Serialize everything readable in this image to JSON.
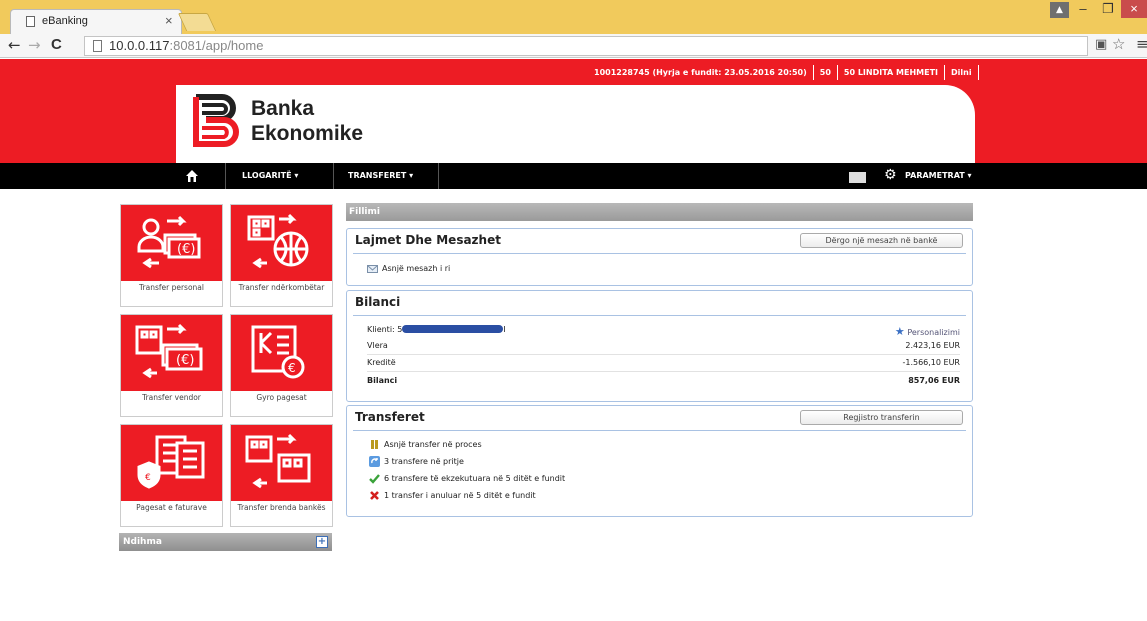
{
  "browser": {
    "tab_title": "eBanking",
    "tab_close": "×",
    "url_host": "10.0.0.117",
    "url_rest": ":8081/app/home",
    "back": "←",
    "forward": "→",
    "reload": "C",
    "window_minimize": "–",
    "window_restore": "❐",
    "window_close": "×",
    "user_glyph": "▲"
  },
  "userbar": {
    "login_info": "1001228745  (Hyrja e fundit: 23.05.2016 20:50)",
    "count": "50",
    "user_name": "50 LINDITA MEHMETI",
    "logout": "Dilni"
  },
  "logo": {
    "line1": "Banka",
    "line2": "Ekonomike"
  },
  "menu": {
    "accounts": "LLOGARITË ▾",
    "transfers": "TRANSFERET ▾",
    "settings": "PARAMETRAT ▾"
  },
  "tiles": [
    {
      "label": "Transfer personal"
    },
    {
      "label": "Transfer ndërkombëtar"
    },
    {
      "label": "Transfer vendor"
    },
    {
      "label": "Gyro pagesat"
    },
    {
      "label": "Pagesat e faturave"
    },
    {
      "label": "Transfer brenda bankës"
    }
  ],
  "help": {
    "label": "Ndihma",
    "expand": "+"
  },
  "crumb": "Fillimi",
  "news": {
    "title": "Lajmet Dhe Mesazhet",
    "button": "Dërgo një mesazh në bankë",
    "empty": "Asnjë mesazh i ri"
  },
  "balance": {
    "title": "Bilanci",
    "client_label": "Klienti: 5",
    "client_suffix": "I",
    "personalize": "Personalizimi",
    "rows": [
      {
        "label": "Vlera",
        "value": "2.423,16  EUR"
      },
      {
        "label": "Kreditë",
        "value": "-1.566,10 EUR"
      },
      {
        "label": "Bilanci",
        "value": "857,06 EUR"
      }
    ]
  },
  "transfers": {
    "title": "Transferet",
    "button": "Regjistro transferin",
    "lines": [
      "Asnjë transfer në proces",
      "3 transfere në pritje",
      "6 transfere të ekzekutuara në 5 ditët e fundit",
      "1 transfer i anuluar në 5 ditët e fundit"
    ]
  },
  "colors": {
    "brand_red": "#ed1c24",
    "panel_border": "#a9c2e3",
    "menu_bg": "#000000"
  }
}
